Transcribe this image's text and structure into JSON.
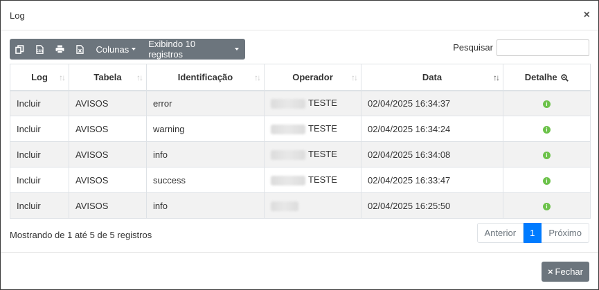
{
  "modal": {
    "title": "Log",
    "close_glyph": "×"
  },
  "toolbar": {
    "icons": [
      "copy-icon",
      "csv-icon",
      "print-icon",
      "excel-icon"
    ],
    "columns_label": "Colunas",
    "show_label": "Exibindo 10 registros"
  },
  "search": {
    "label": "Pesquisar",
    "value": ""
  },
  "table": {
    "headers": [
      "Log",
      "Tabela",
      "Identificação",
      "Operador",
      "Data",
      "Detalhe"
    ],
    "rows": [
      {
        "log": "Incluir",
        "tabela": "AVISOS",
        "identificacao": "error",
        "operador": "TESTE",
        "data": "02/04/2025 16:34:37"
      },
      {
        "log": "Incluir",
        "tabela": "AVISOS",
        "identificacao": "warning",
        "operador": "TESTE",
        "data": "02/04/2025 16:34:24"
      },
      {
        "log": "Incluir",
        "tabela": "AVISOS",
        "identificacao": "info",
        "operador": "TESTE",
        "data": "02/04/2025 16:34:08"
      },
      {
        "log": "Incluir",
        "tabela": "AVISOS",
        "identificacao": "success",
        "operador": "TESTE",
        "data": "02/04/2025 16:33:47"
      },
      {
        "log": "Incluir",
        "tabela": "AVISOS",
        "identificacao": "info",
        "operador": "",
        "data": "02/04/2025 16:25:50"
      }
    ]
  },
  "footer": {
    "info": "Mostrando de 1 até 5 de 5 registros",
    "prev": "Anterior",
    "page": "1",
    "next": "Próximo",
    "close_label": "Fechar"
  },
  "colors": {
    "toolbar_bg": "#6c757d",
    "active_page": "#007bff",
    "detail_icon": "#6cc24a"
  }
}
